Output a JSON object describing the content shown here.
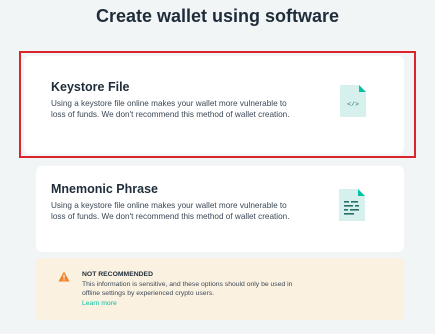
{
  "page": {
    "title": "Create wallet using software"
  },
  "options": [
    {
      "title": "Keystore File",
      "description": "Using a keystore file online makes your wallet more vulnerable to loss of funds. We don't recommend this method of wallet creation.",
      "icon": "code-file-icon",
      "selected": true
    },
    {
      "title": "Mnemonic Phrase",
      "description": "Using a keystore file online makes your wallet more vulnerable to loss of funds. We don't recommend this method of wallet creation.",
      "icon": "text-file-icon",
      "selected": false
    }
  ],
  "warning": {
    "heading": "NOT RECOMMENDED",
    "text": "This information is sensitive, and these options should only be used in offline settings by experienced crypto users.",
    "link": "Learn more"
  },
  "colors": {
    "background": "#f2f5f6",
    "highlight": "#d9252b",
    "icon_fill": "#d6f1ed",
    "icon_accent": "#05c0a5",
    "warning_bg": "#fbf1e1",
    "warning_icon": "#f0832c"
  }
}
